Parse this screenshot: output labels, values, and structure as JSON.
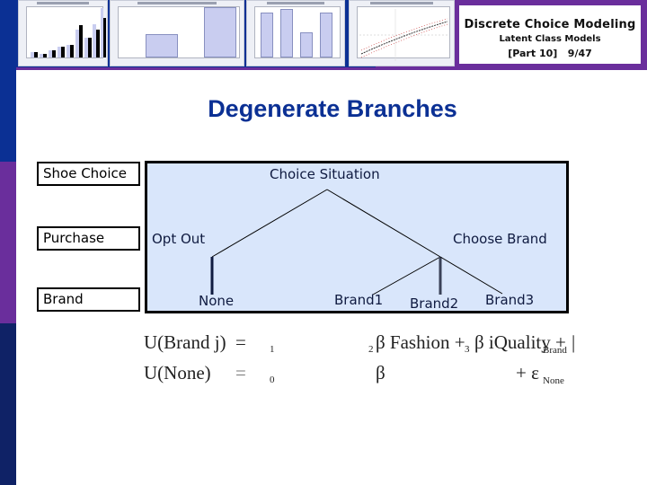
{
  "header": {
    "course_title": "Discrete Choice Modeling",
    "subtitle": "Latent Class Models",
    "part": "[Part  10]",
    "page": "9/47"
  },
  "colors": {
    "brand_blue": "#0b3094",
    "brand_purple": "#6a2e9c",
    "dark_navy": "#0f2266",
    "tree_fill": "#d9e6fb"
  },
  "slide": {
    "title": "Degenerate Branches"
  },
  "levels": [
    {
      "label": "Shoe Choice"
    },
    {
      "label": "Purchase"
    },
    {
      "label": "Brand"
    }
  ],
  "tree": {
    "root": "Choice Situation",
    "branches": [
      "Opt Out",
      "Choose Brand"
    ],
    "leaves": [
      "None",
      "Brand1",
      "Brand2",
      "Brand3"
    ]
  },
  "equations": [
    {
      "lhs": "U(Brand j)",
      "eq": "=",
      "sub1": "1",
      "sub2": "2",
      "body1": "β Fashion +",
      "sub3": "3",
      "body2": "β iQuality +",
      "err_sub": "Brand",
      "tail": "|"
    },
    {
      "lhs": "U(None)",
      "eq": "=",
      "sub1": "0",
      "body1": "β",
      "err": "+ ε",
      "err_sub": "None"
    }
  ]
}
